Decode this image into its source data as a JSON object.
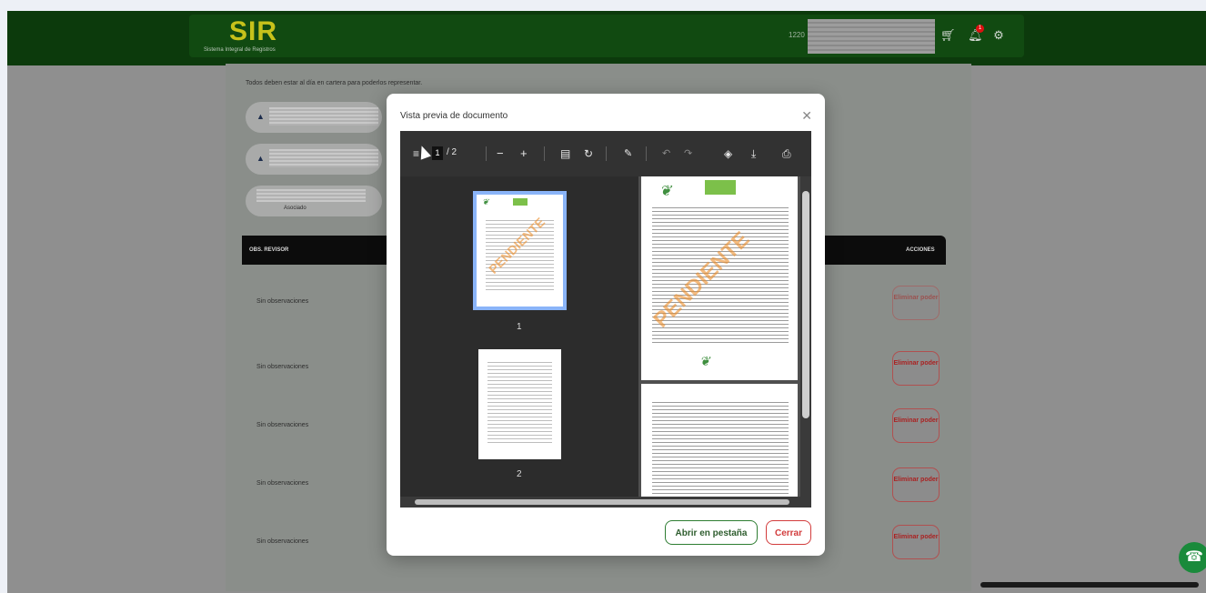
{
  "app": {
    "logo": "SIR",
    "subtitle": "Sistema Integral de Registros",
    "user_id": "1220",
    "notification_count": "1"
  },
  "background": {
    "notice": "Todos deben estar al día en cartera para poderlos representar.",
    "person_role": "Asociado",
    "table_headers": {
      "left": "OBS. REVISOR",
      "right": "ACCIONES"
    },
    "rows": [
      {
        "obs": "Sin observaciones",
        "action": "Eliminar poder"
      },
      {
        "obs": "Sin observaciones",
        "action": "Eliminar poder"
      },
      {
        "obs": "Sin observaciones",
        "action": "Eliminar poder"
      },
      {
        "obs": "Sin observaciones",
        "action": "Eliminar poder"
      },
      {
        "obs": "Sin observaciones",
        "action": "Eliminar poder"
      }
    ]
  },
  "modal": {
    "title": "Vista previa de documento",
    "close_symbol": "✕",
    "pdf": {
      "current_page": "1",
      "total_pages": "/ 2",
      "thumb_labels": [
        "1",
        "2"
      ],
      "watermark": "PENDIENTE"
    },
    "buttons": {
      "open_tab": "Abrir en pestaña",
      "close": "Cerrar"
    }
  },
  "colors": {
    "header_green": "#0c3a0c",
    "accent_red": "#d23c3c",
    "accent_green": "#2e7d32",
    "thumb_selected": "#8ab4f8"
  }
}
